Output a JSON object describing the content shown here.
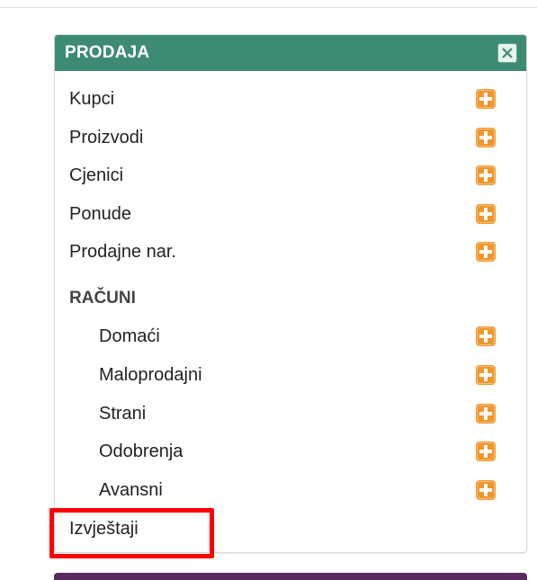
{
  "panel": {
    "title": "PRODAJA",
    "header_color": "#3d8b75"
  },
  "items": [
    {
      "label": "Kupci",
      "has_add": true
    },
    {
      "label": "Proizvodi",
      "has_add": true
    },
    {
      "label": "Cjenici",
      "has_add": true
    },
    {
      "label": "Ponude",
      "has_add": true
    },
    {
      "label": "Prodajne nar.",
      "has_add": true
    }
  ],
  "section": {
    "title": "RAČUNI",
    "items": [
      {
        "label": "Domaći",
        "has_add": true
      },
      {
        "label": "Maloprodajni",
        "has_add": true
      },
      {
        "label": "Strani",
        "has_add": true
      },
      {
        "label": "Odobrenja",
        "has_add": true
      },
      {
        "label": "Avansni",
        "has_add": true
      }
    ]
  },
  "footer_item": {
    "label": "Izvještaji",
    "highlighted": true
  },
  "colors": {
    "add_icon": "#f0962c",
    "highlight": "#ff0000",
    "bottom_bar": "#5b2a5e"
  }
}
